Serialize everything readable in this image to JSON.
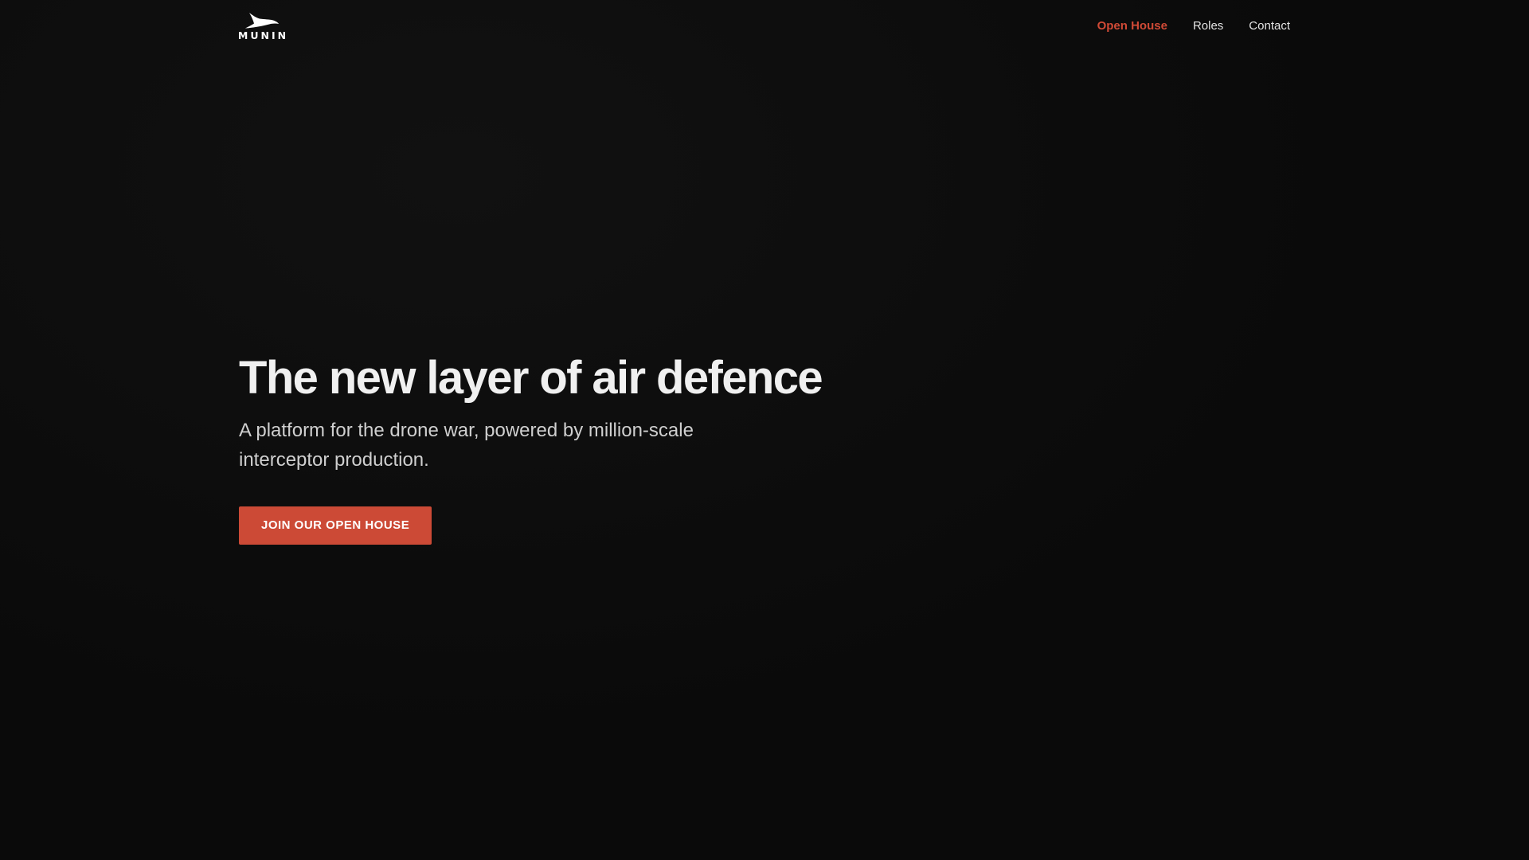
{
  "brand": {
    "name": "MUNIN",
    "logo_icon": "raven-icon"
  },
  "nav": {
    "items": [
      {
        "label": "Open House",
        "active": true
      },
      {
        "label": "Roles",
        "active": false
      },
      {
        "label": "Contact",
        "active": false
      }
    ]
  },
  "hero": {
    "title": "The new layer of air defence",
    "subtitle": "A platform for the drone war, powered by million-scale interceptor production.",
    "cta_label": "JOIN OUR OPEN HOUSE"
  },
  "colors": {
    "background": "#0a0a0a",
    "accent": "#cc4a36",
    "text_primary": "#f0f0f0",
    "text_secondary": "#cfcfcf"
  }
}
